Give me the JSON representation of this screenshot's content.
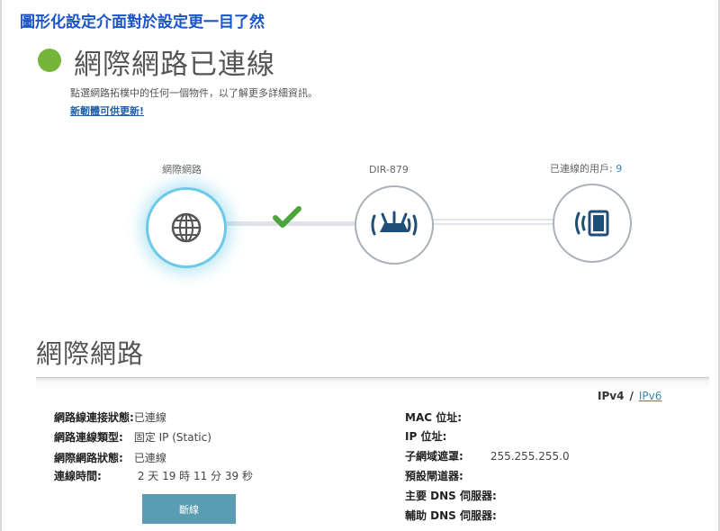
{
  "caption": "圖形化設定介面對於設定更一目了然",
  "header": {
    "title": "網際網路已連線",
    "subtitle": "點選網路拓樸中的任何一個物件，以了解更多詳細資訊。",
    "firmware_link": "新韌體可供更新!"
  },
  "topology": {
    "internet_label": "網際網路",
    "router_label": "DIR-879",
    "clients_label": "已連線的用戶:",
    "clients_count": "9"
  },
  "section": {
    "title": "網際網路"
  },
  "ip_version": {
    "ipv4": "IPv4",
    "separator": "/",
    "ipv6": "IPv6"
  },
  "left_info": [
    {
      "label": "網路線連接狀態:",
      "value": "已連線"
    },
    {
      "label": "網路連線類型:",
      "value": "固定 IP (Static)"
    },
    {
      "label": "網際網路狀態:",
      "value": "已連線"
    },
    {
      "label": "連線時間:",
      "value": "2 天 19 時 11 分 39 秒"
    }
  ],
  "right_info": [
    {
      "label": "MAC 位址:",
      "value": ""
    },
    {
      "label": "IP 位址:",
      "value": ""
    },
    {
      "label": "子網域遮罩:",
      "value": "255.255.255.0"
    },
    {
      "label": "預設閘道器:",
      "value": ""
    },
    {
      "label": "主要 DNS 伺服器:",
      "value": ""
    },
    {
      "label": "輔助 DNS 伺服器:",
      "value": ""
    }
  ],
  "disconnect_button": "斷線",
  "colors": {
    "status_green": "#74b53a",
    "internet_glow": "#6cc9e8",
    "accent_blue": "#3a86b8",
    "caption_blue": "#1a55c8",
    "button_teal": "#5a9db3"
  }
}
